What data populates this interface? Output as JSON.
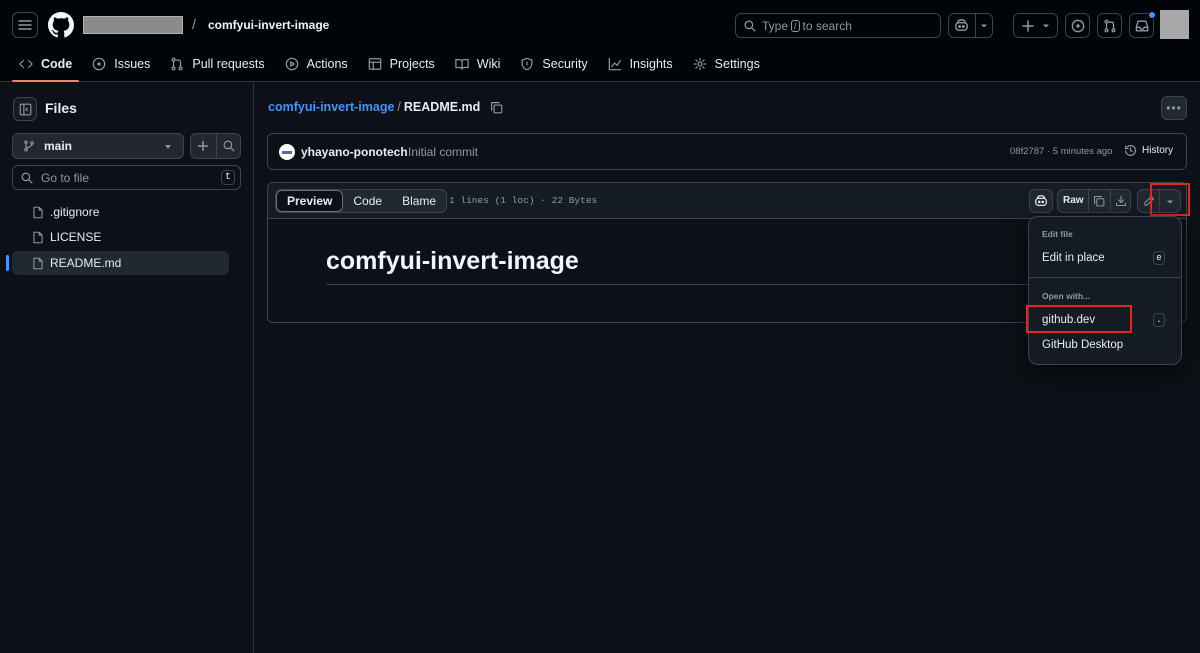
{
  "header": {
    "repo_name": "comfyui-invert-image",
    "separator": "/",
    "search_text_before": "Type",
    "search_kbd": "/",
    "search_text_after": "to search"
  },
  "tabs": [
    {
      "label": "Code",
      "icon": "code-icon",
      "active": true
    },
    {
      "label": "Issues",
      "icon": "issue-opened-icon"
    },
    {
      "label": "Pull requests",
      "icon": "git-pull-request-icon"
    },
    {
      "label": "Actions",
      "icon": "play-icon"
    },
    {
      "label": "Projects",
      "icon": "table-icon"
    },
    {
      "label": "Wiki",
      "icon": "book-icon"
    },
    {
      "label": "Security",
      "icon": "shield-icon"
    },
    {
      "label": "Insights",
      "icon": "graph-icon"
    },
    {
      "label": "Settings",
      "icon": "gear-icon"
    }
  ],
  "sidebar": {
    "title": "Files",
    "branch": "main",
    "goto_placeholder": "Go to file",
    "goto_kbd": "t",
    "files": [
      {
        "name": ".gitignore"
      },
      {
        "name": "LICENSE"
      },
      {
        "name": "README.md",
        "active": true
      }
    ]
  },
  "breadcrumb": {
    "repo": "comfyui-invert-image",
    "separator": "/",
    "file": "README.md"
  },
  "commit": {
    "author": "yhayano-ponotech",
    "message": "Initial commit",
    "meta": "08f2787 · 5 minutes ago",
    "history_label": "History"
  },
  "file_view": {
    "modes": [
      "Preview",
      "Code",
      "Blame"
    ],
    "active_mode": "Preview",
    "stats": "1 lines (1 loc) · 22 Bytes",
    "raw_label": "Raw",
    "heading": "comfyui-invert-image"
  },
  "dropdown": {
    "edit_heading": "Edit file",
    "edit_in_place": "Edit in place",
    "edit_in_place_kbd": "e",
    "open_with_heading": "Open with...",
    "github_dev": "github.dev",
    "github_dev_kbd": ".",
    "github_desktop": "GitHub Desktop"
  },
  "colors": {
    "background": "#0d1117",
    "header_bg": "#010409",
    "accent_link": "#4493f8",
    "tab_underline": "#f78166",
    "highlight_box": "#e5261f"
  }
}
